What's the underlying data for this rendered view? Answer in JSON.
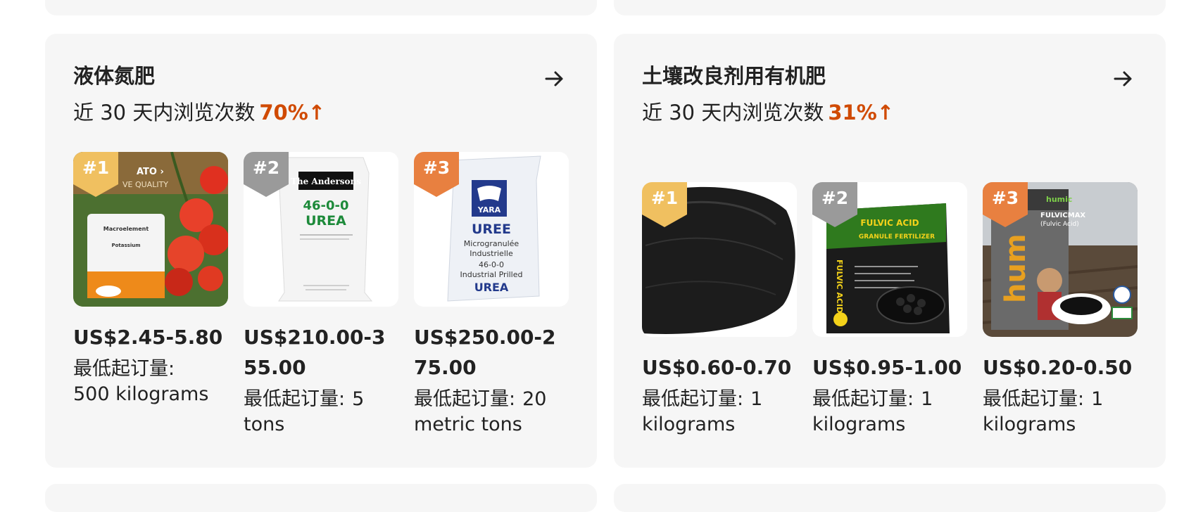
{
  "colors": {
    "accent": "#d04a02",
    "card_bg": "#f6f6f6",
    "rank1": "#f0c060",
    "rank2": "#9a9a9a",
    "rank3": "#e88040"
  },
  "cards": [
    {
      "title": "液体氮肥",
      "subtitle": "近 30 天内浏览次数",
      "percent": "70%",
      "arrow_icon": "arrow-right-icon",
      "products": [
        {
          "rank": "#1",
          "price": "US$2.45-5.80",
          "moq_label": "最低起订量:",
          "moq_value": "500 kilograms",
          "image_text": {
            "brand": "ATO ›",
            "tag": "VE QUALITY",
            "pack": "Macroelement",
            "pack2": "Potassium"
          }
        },
        {
          "rank": "#2",
          "price": "US$210.00-355.00",
          "moq_label": "最低起订量:",
          "moq_value": "5 tons",
          "image_text": {
            "brand": "The Andersons",
            "grade": "46-0-0",
            "name": "UREA"
          }
        },
        {
          "rank": "#3",
          "price": "US$250.00-275.00",
          "moq_label": "最低起订量:",
          "moq_value": "20 metric tons",
          "image_text": {
            "brand": "YARA",
            "name": "UREE",
            "l1": "Microgranulée",
            "l2": "Industrielle",
            "l3": "46-0-0",
            "l4": "Industrial Prilled",
            "l5": "UREA"
          }
        }
      ]
    },
    {
      "title": "土壤改良剂用有机肥",
      "subtitle": "近 30 天内浏览次数",
      "percent": "31%",
      "arrow_icon": "arrow-right-icon",
      "products": [
        {
          "rank": "#1",
          "price": "US$0.60-0.70",
          "moq_label": "最低起订量:",
          "moq_value": "1 kilograms",
          "image_text": {}
        },
        {
          "rank": "#2",
          "price": "US$0.95-1.00",
          "moq_label": "最低起订量:",
          "moq_value": "1 kilograms",
          "image_text": {
            "name": "FULVIC ACID",
            "sub": "GRANULE FERTILIZER",
            "side": "FULVIC ACID"
          }
        },
        {
          "rank": "#3",
          "price": "US$0.20-0.50",
          "moq_label": "最低起订量:",
          "moq_value": "1 kilograms",
          "image_text": {
            "brand": "humic",
            "name": "FULVICMAX",
            "sub": "(Fulvic Acid)",
            "big": "hum"
          }
        }
      ]
    }
  ]
}
